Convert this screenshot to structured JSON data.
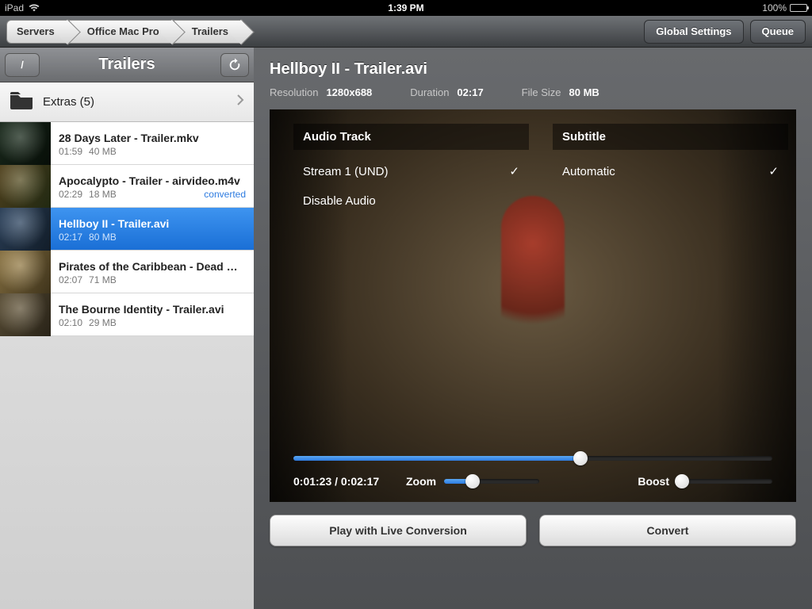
{
  "statusbar": {
    "device": "iPad",
    "time": "1:39 PM",
    "battery_pct": "100%"
  },
  "topnav": {
    "crumbs": [
      "Servers",
      "Office Mac Pro",
      "Trailers"
    ],
    "global_settings": "Global Settings",
    "queue": "Queue"
  },
  "sidebar": {
    "back_label": "/",
    "title": "Trailers",
    "folder": {
      "label": "Extras (5)"
    },
    "files": [
      {
        "name": "28 Days Later - Trailer.mkv",
        "duration": "01:59",
        "size": "40 MB",
        "badge": "",
        "selected": false
      },
      {
        "name": "Apocalypto - Trailer - airvideo.m4v",
        "duration": "02:29",
        "size": "18 MB",
        "badge": "converted",
        "selected": false
      },
      {
        "name": "Hellboy II - Trailer.avi",
        "duration": "02:17",
        "size": "80 MB",
        "badge": "",
        "selected": true
      },
      {
        "name": "Pirates of the Caribbean - Dead Man's…",
        "duration": "02:07",
        "size": "71 MB",
        "badge": "",
        "selected": false
      },
      {
        "name": "The Bourne Identity - Trailer.avi",
        "duration": "02:10",
        "size": "29 MB",
        "badge": "",
        "selected": false
      }
    ]
  },
  "detail": {
    "title": "Hellboy II - Trailer.avi",
    "resolution_label": "Resolution",
    "resolution": "1280x688",
    "duration_label": "Duration",
    "duration": "02:17",
    "filesize_label": "File Size",
    "filesize": "80 MB",
    "audio_header": "Audio Track",
    "audio_options": [
      "Stream 1 (UND)",
      "Disable Audio"
    ],
    "audio_selected_index": 0,
    "subtitle_header": "Subtitle",
    "subtitle_options": [
      "Automatic"
    ],
    "subtitle_selected_index": 0,
    "progress_pct": 60,
    "time_display": "0:01:23 / 0:02:17",
    "zoom_label": "Zoom",
    "zoom_pct": 30,
    "boost_label": "Boost",
    "boost_pct": 5,
    "play_live": "Play with Live Conversion",
    "convert": "Convert"
  }
}
